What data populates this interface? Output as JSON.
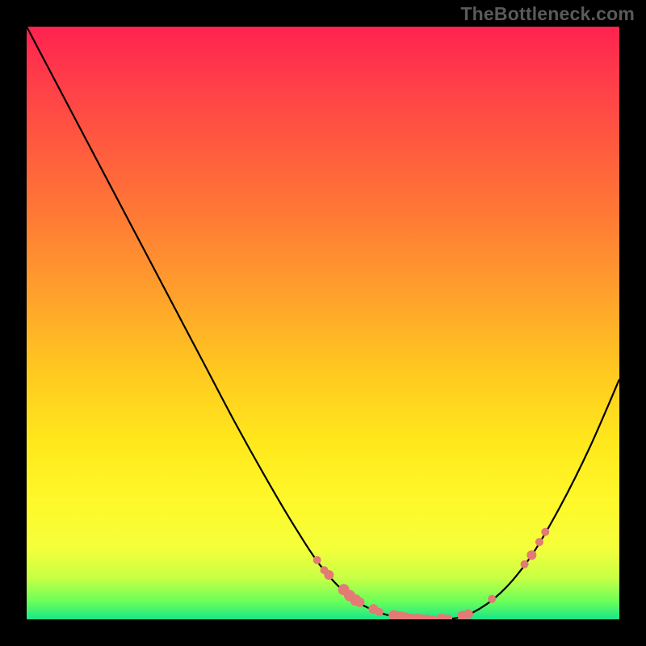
{
  "attribution": "TheBottleneck.com",
  "chart_data": {
    "type": "line",
    "title": "",
    "xlabel": "",
    "ylabel": "",
    "x": [
      0.0,
      0.05,
      0.1,
      0.15,
      0.2,
      0.25,
      0.3,
      0.35,
      0.4,
      0.45,
      0.5,
      0.55,
      0.6,
      0.65,
      0.678,
      0.7,
      0.71,
      0.75,
      0.8,
      0.85,
      0.9,
      0.95,
      1.0
    ],
    "values": [
      1.0,
      0.905,
      0.81,
      0.715,
      0.62,
      0.525,
      0.43,
      0.335,
      0.245,
      0.16,
      0.085,
      0.035,
      0.01,
      0.0,
      0.0,
      0.0,
      0.0,
      0.01,
      0.045,
      0.105,
      0.19,
      0.29,
      0.405
    ],
    "xlim": [
      0,
      1
    ],
    "ylim": [
      0,
      1
    ],
    "annotations": {
      "curve_markers_x": [
        0.49,
        0.502,
        0.51,
        0.535,
        0.545,
        0.555,
        0.562,
        0.585,
        0.595,
        0.62,
        0.63,
        0.638,
        0.648,
        0.66,
        0.668,
        0.675,
        0.685,
        0.7,
        0.71,
        0.735,
        0.745,
        0.785,
        0.84,
        0.852,
        0.865,
        0.875
      ],
      "curve_markers_r": [
        5,
        5,
        6,
        7,
        7,
        7,
        6,
        6,
        5,
        7,
        7,
        7,
        7,
        7,
        6,
        6,
        5,
        7,
        6,
        6,
        6,
        5,
        5,
        6,
        5,
        5
      ]
    }
  }
}
